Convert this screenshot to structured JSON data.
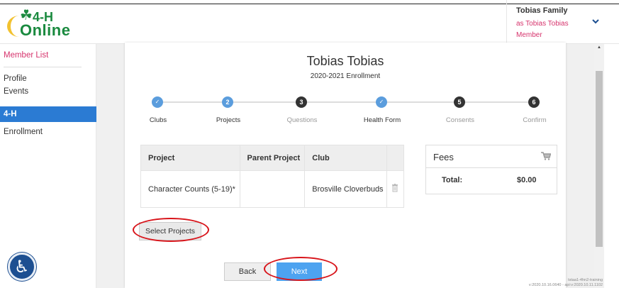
{
  "header": {
    "family_name": "Tobias Family",
    "role_line1": "as Tobias Tobias",
    "role_line2": "Member"
  },
  "logo": {
    "mark": "4-H",
    "word": "Online",
    "icon": "clover-icon"
  },
  "sidebar": {
    "items": [
      {
        "label": "Member List",
        "style": "link"
      },
      {
        "label": "Profile"
      },
      {
        "label": "Events"
      },
      {
        "label": "4-H",
        "active": true
      },
      {
        "label": "Enrollment"
      }
    ]
  },
  "enrollment": {
    "member_name": "Tobias Tobias",
    "year": "2020-2021 Enrollment"
  },
  "steps": [
    {
      "num": "✓",
      "label": "Clubs",
      "state": "complete"
    },
    {
      "num": "2",
      "label": "Projects",
      "state": "current"
    },
    {
      "num": "3",
      "label": "Questions",
      "state": "pending"
    },
    {
      "num": "✓",
      "label": "Health Form",
      "state": "complete"
    },
    {
      "num": "5",
      "label": "Consents",
      "state": "pending"
    },
    {
      "num": "6",
      "label": "Confirm",
      "state": "pending"
    }
  ],
  "projects_table": {
    "headers": [
      "Project",
      "Parent Project",
      "Club"
    ],
    "rows": [
      {
        "project": "Character Counts (5-19)*",
        "parent": "",
        "club": "Brosville Cloverbuds"
      }
    ]
  },
  "fees": {
    "title": "Fees",
    "total_label": "Total:",
    "total_value": "$0.00"
  },
  "buttons": {
    "select_projects": "Select Projects",
    "back": "Back",
    "next": "Next"
  },
  "version": {
    "line1": "tstaa1-4hn2-training",
    "line2": "v:2020.10.16.0640 - api:v:2020.10.11.1102"
  },
  "colors": {
    "accent": "#2b7bd3",
    "link": "#d6336c",
    "next": "#4da3f0",
    "annotation": "#d8141a"
  }
}
